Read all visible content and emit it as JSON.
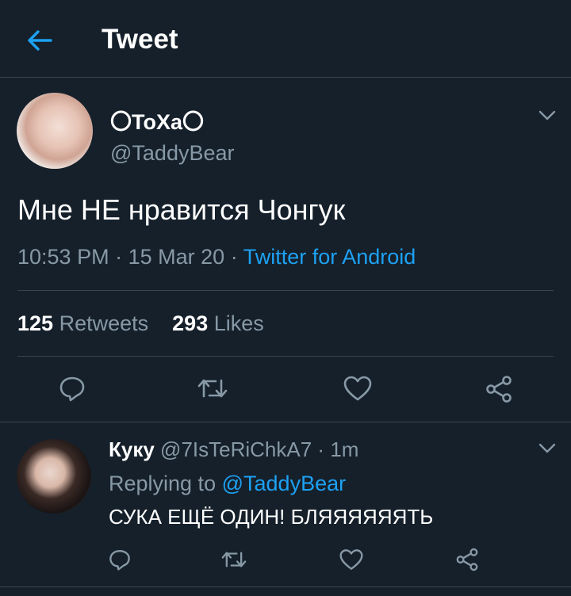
{
  "header": {
    "title": "Tweet"
  },
  "tweet": {
    "name": "〇ToXa〇",
    "handle": "@TaddyBear",
    "text": "Мне НЕ нравится Чонгук",
    "time": "10:53 PM",
    "date": "15 Mar 20",
    "separator": "·",
    "source": "Twitter for Android",
    "retweets": "125",
    "retweets_label": "Retweets",
    "likes": "293",
    "likes_label": "Likes"
  },
  "reply": {
    "name": "Куку",
    "handle": "@7IsTeRiChkA7",
    "time": "1m",
    "replying_label": "Replying to",
    "replying_to": "@TaddyBear",
    "text": "СУКА ЕЩЁ ОДИН! БЛЯЯЯЯЯЯТЬ"
  },
  "colors": {
    "background": "#15202b",
    "accent": "#1da1f2",
    "muted": "#8899a6",
    "divider": "#38444d"
  },
  "icons": [
    "back-arrow-icon",
    "chevron-down-icon",
    "reply-icon",
    "retweet-icon",
    "like-icon",
    "share-icon"
  ]
}
